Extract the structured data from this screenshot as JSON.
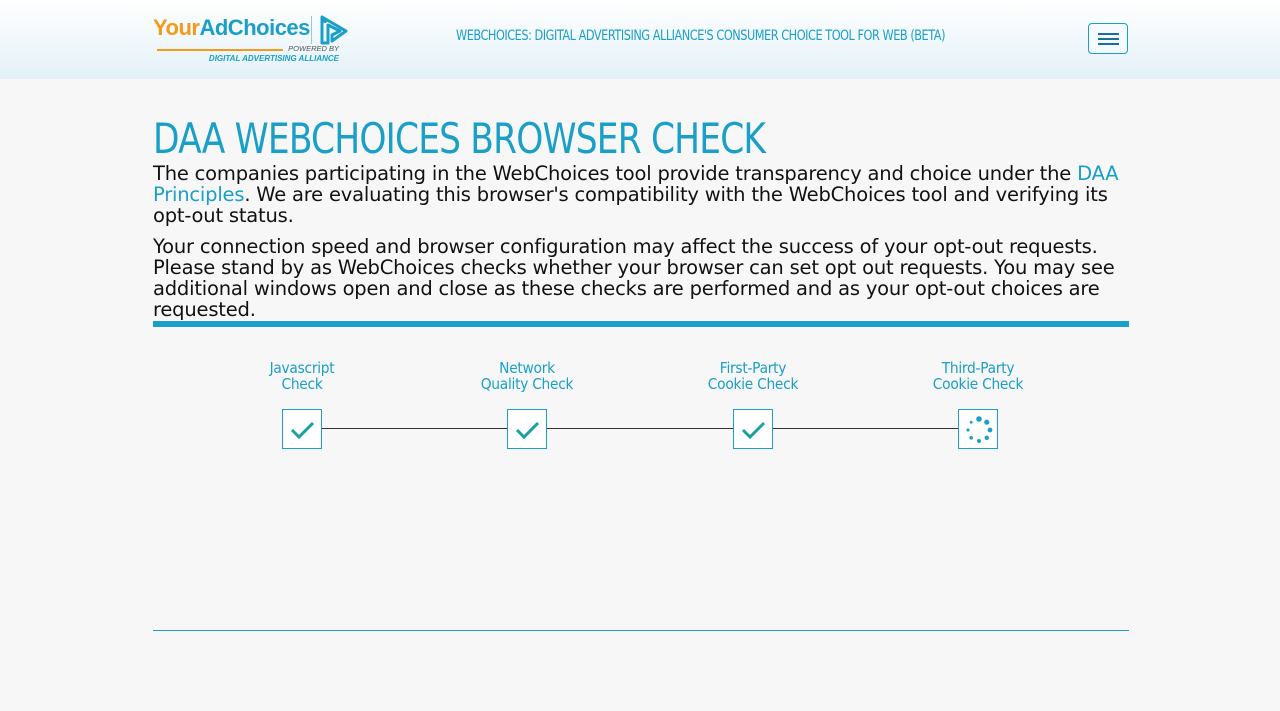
{
  "logo": {
    "brand_part1": "Your",
    "brand_part2": "AdChoices",
    "powered_by": "POWERED BY",
    "alliance": "DIGITAL ADVERTISING ALLIANCE"
  },
  "header": {
    "title": "WEBCHOICES: DIGITAL ADVERTISING ALLIANCE'S CONSUMER CHOICE TOOL FOR WEB (BETA)",
    "menu_icon": "hamburger-icon"
  },
  "main": {
    "title": "DAA WEBCHOICES BROWSER CHECK",
    "intro_before_link": "The companies participating in the WebChoices tool provide transparency and choice under the ",
    "intro_link": "DAA Principles",
    "intro_after_link": ". We are evaluating this browser's compatibility with the WebChoices tool and verifying its opt-out status.",
    "notice": "Your connection speed and browser configuration may affect the success of your opt-out requests. Please stand by as WebChoices checks whether your browser can set opt out requests. You may see additional windows open and close as these checks are performed and as your opt-out choices are requested."
  },
  "steps": [
    {
      "line1": "Javascript",
      "line2": "Check",
      "status": "complete",
      "icon": "check-icon"
    },
    {
      "line1": "Network",
      "line2": "Quality Check",
      "status": "complete",
      "icon": "check-icon"
    },
    {
      "line1": "First-Party",
      "line2": "Cookie Check",
      "status": "complete",
      "icon": "check-icon"
    },
    {
      "line1": "Third-Party",
      "line2": "Cookie Check",
      "status": "in-progress",
      "icon": "spinner-icon"
    }
  ],
  "colors": {
    "accent": "#1a9fc9",
    "brand_orange": "#f29b1d",
    "check": "#1aa0a0"
  }
}
